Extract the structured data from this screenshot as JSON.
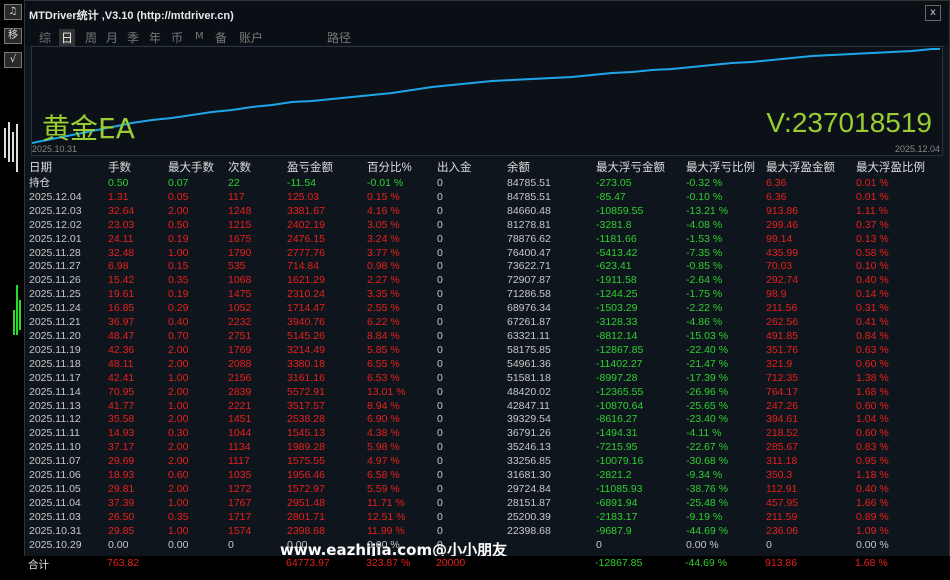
{
  "window": {
    "title": "MTDriver统计 ,V3.10 (http://mtdriver.cn)",
    "close": "x"
  },
  "side": {
    "btn1": "♫",
    "btn2": "移",
    "btn3": "√"
  },
  "tabs": [
    "综",
    "日",
    "周",
    "月",
    "季",
    "年",
    "币",
    "M",
    "备",
    "账户",
    "路径"
  ],
  "chart": {
    "left_label": "黄金EA",
    "right_label": "V:237018519",
    "date_start": "2025.10.31",
    "date_end": "2025.12.04",
    "curve_color": "#1ea6e8"
  },
  "headers": [
    "日期",
    "手数",
    "最大手数",
    "次数",
    "盈亏金额",
    "百分比%",
    "出入金",
    "余额",
    "最大浮亏金额",
    "最大浮亏比例",
    "最大浮盈金额",
    "最大浮盈比例"
  ],
  "hold": [
    "持仓",
    "0.50",
    "0.07",
    "22",
    "-11.54",
    "-0.01 %",
    "0",
    "84785.51",
    "-273.05",
    "-0.32 %",
    "6.36",
    "0.01 %"
  ],
  "rows": [
    [
      "2025.12.04",
      "1.31",
      "0.05",
      "117",
      "125.03",
      "0.15 %",
      "0",
      "84785.51",
      "-85.47",
      "-0.10 %",
      "6.36",
      "0.01 %"
    ],
    [
      "2025.12.03",
      "32.64",
      "2.00",
      "1248",
      "3381.67",
      "4.16 %",
      "0",
      "84660.48",
      "-10859.55",
      "-13.21 %",
      "913.86",
      "1.11 %"
    ],
    [
      "2025.12.02",
      "23.03",
      "0.50",
      "1215",
      "2402.19",
      "3.05 %",
      "0",
      "81278.81",
      "-3281.8",
      "-4.08 %",
      "299.46",
      "0.37 %"
    ],
    [
      "2025.12.01",
      "24.11",
      "0.19",
      "1675",
      "2476.15",
      "3.24 %",
      "0",
      "78876.62",
      "-1181.66",
      "-1.53 %",
      "99.14",
      "0.13 %"
    ],
    [
      "2025.11.28",
      "32.48",
      "1.00",
      "1790",
      "2777.76",
      "3.77 %",
      "0",
      "76400.47",
      "-5413.42",
      "-7.35 %",
      "435.99",
      "0.58 %"
    ],
    [
      "2025.11.27",
      "6.98",
      "0.15",
      "535",
      "714.84",
      "0.98 %",
      "0",
      "73622.71",
      "-623.41",
      "-0.85 %",
      "70.03",
      "0.10 %"
    ],
    [
      "2025.11.26",
      "15.42",
      "0.35",
      "1068",
      "1621.29",
      "2.27 %",
      "0",
      "72907.87",
      "-1911.58",
      "-2.64 %",
      "292.74",
      "0.40 %"
    ],
    [
      "2025.11.25",
      "19.61",
      "0.19",
      "1475",
      "2310.24",
      "3.35 %",
      "0",
      "71286.58",
      "-1244.25",
      "-1.75 %",
      "98.9",
      "0.14 %"
    ],
    [
      "2025.11.24",
      "16.85",
      "0.29",
      "1052",
      "1714.47",
      "2.55 %",
      "0",
      "68976.34",
      "-1503.29",
      "-2.22 %",
      "211.56",
      "0.31 %"
    ],
    [
      "2025.11.21",
      "36.97",
      "0.40",
      "2232",
      "3940.76",
      "6.22 %",
      "0",
      "67261.87",
      "-3128.33",
      "-4.86 %",
      "262.56",
      "0.41 %"
    ],
    [
      "2025.11.20",
      "48.47",
      "0.70",
      "2751",
      "5145.26",
      "8.84 %",
      "0",
      "63321.11",
      "-8812.14",
      "-15.03 %",
      "491.85",
      "0.84 %"
    ],
    [
      "2025.11.19",
      "42.36",
      "2.00",
      "1769",
      "3214.49",
      "5.85 %",
      "0",
      "58175.85",
      "-12867.85",
      "-22.40 %",
      "351.76",
      "0.63 %"
    ],
    [
      "2025.11.18",
      "48.11",
      "2.00",
      "2088",
      "3380.18",
      "6.55 %",
      "0",
      "54961.36",
      "-11402.27",
      "-21.47 %",
      "321.9",
      "0.60 %"
    ],
    [
      "2025.11.17",
      "42.41",
      "1.00",
      "2156",
      "3161.16",
      "6.53 %",
      "0",
      "51581.18",
      "-8997.28",
      "-17.39 %",
      "712.35",
      "1.38 %"
    ],
    [
      "2025.11.14",
      "70.95",
      "2.00",
      "2839",
      "5572.91",
      "13.01 %",
      "0",
      "48420.02",
      "-12365.55",
      "-26.96 %",
      "764.17",
      "1.68 %"
    ],
    [
      "2025.11.13",
      "41.77",
      "1.00",
      "2221",
      "3517.57",
      "8.94 %",
      "0",
      "42847.11",
      "-10870.64",
      "-25.65 %",
      "247.26",
      "0.60 %"
    ],
    [
      "2025.11.12",
      "35.58",
      "2.00",
      "1451",
      "2538.28",
      "6.90 %",
      "0",
      "39329.54",
      "-8616.27",
      "-23.40 %",
      "394.61",
      "1.04 %"
    ],
    [
      "2025.11.11",
      "14.93",
      "0.30",
      "1044",
      "1545.13",
      "4.38 %",
      "0",
      "36791.26",
      "-1494.31",
      "-4.11 %",
      "218.52",
      "0.60 %"
    ],
    [
      "2025.11.10",
      "37.17",
      "2.00",
      "1134",
      "1989.28",
      "5.98 %",
      "0",
      "35246.13",
      "-7215.95",
      "-22.67 %",
      "285.67",
      "0.83 %"
    ],
    [
      "2025.11.07",
      "29.69",
      "2.00",
      "1117",
      "1575.55",
      "4.97 %",
      "0",
      "33256.85",
      "-10079.16",
      "-30.68 %",
      "311.18",
      "0.95 %"
    ],
    [
      "2025.11.06",
      "18.93",
      "0.60",
      "1035",
      "1956.46",
      "6.58 %",
      "0",
      "31681.30",
      "-2821.2",
      "-9.34 %",
      "350.3",
      "1.18 %"
    ],
    [
      "2025.11.05",
      "29.81",
      "2.00",
      "1272",
      "1572.97",
      "5.59 %",
      "0",
      "29724.84",
      "-11085.93",
      "-38.76 %",
      "112.91",
      "0.40 %"
    ],
    [
      "2025.11.04",
      "37.39",
      "1.00",
      "1767",
      "2951.48",
      "11.71 %",
      "0",
      "28151.87",
      "-6891.94",
      "-25.48 %",
      "457.95",
      "1.66 %"
    ],
    [
      "2025.11.03",
      "26.50",
      "0.35",
      "1717",
      "2801.71",
      "12.51 %",
      "0",
      "25200.39",
      "-2183.17",
      "-9.19 %",
      "211.59",
      "0.89 %"
    ],
    [
      "2025.10.31",
      "29.85",
      "1.00",
      "1574",
      "2398.68",
      "11.99 %",
      "0",
      "22398.68",
      "-9687.9",
      "-44.69 %",
      "236.06",
      "1.09 %"
    ],
    [
      "2025.10.29",
      "0.00",
      "0.00",
      "0",
      "0.00",
      "0.00 %",
      "0",
      "",
      "0",
      "0.00 %",
      "0",
      "0.00 %"
    ]
  ],
  "total": [
    "合计",
    "763.82",
    "",
    "",
    "64773.97",
    "323.87 %",
    "20000",
    "",
    "-12867.85",
    "-44.69 %",
    "913.86",
    "1.68 %"
  ],
  "watermark": "www.eazhijia.com@小小朋友"
}
